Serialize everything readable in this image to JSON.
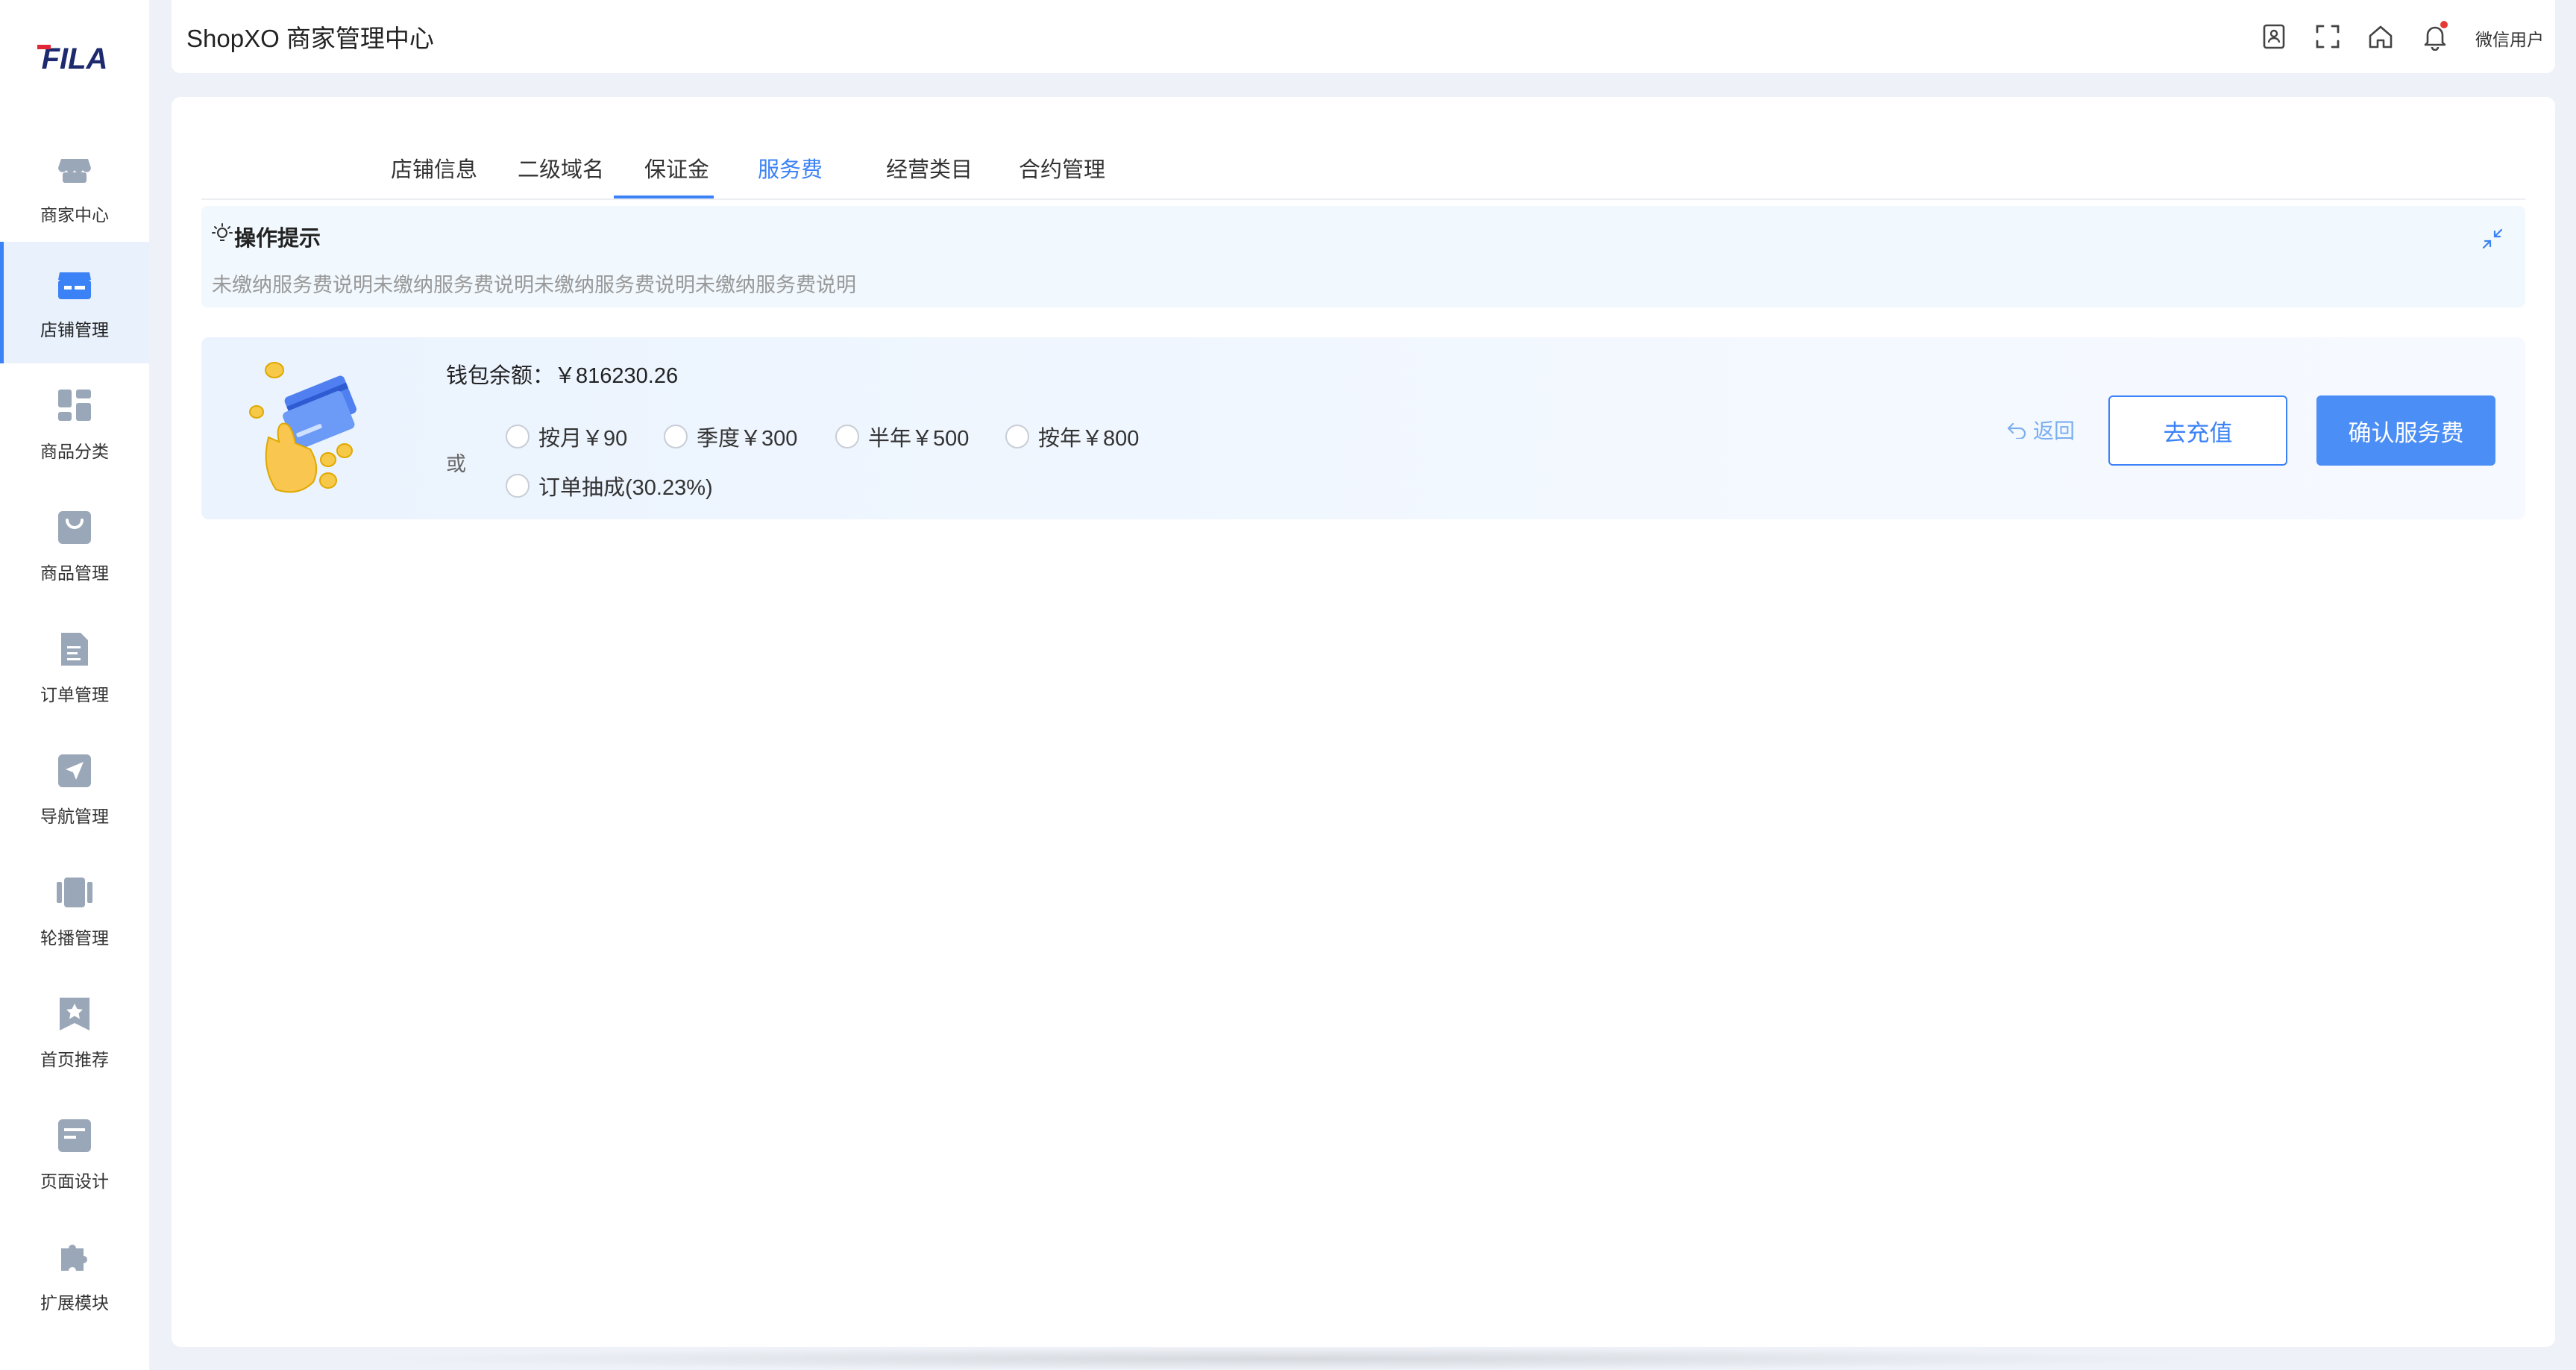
{
  "brand": {
    "logo_text": "FILA",
    "brand_color": "#1e2a6e",
    "accent_color": "#e32636"
  },
  "sidebar": {
    "items": [
      {
        "label": "商家中心",
        "icon": "store-awning-icon"
      },
      {
        "label": "店铺管理",
        "icon": "shop-icon",
        "active": true
      },
      {
        "label": "商品分类",
        "icon": "category-grid-icon"
      },
      {
        "label": "商品管理",
        "icon": "shopping-bag-icon"
      },
      {
        "label": "订单管理",
        "icon": "document-icon"
      },
      {
        "label": "导航管理",
        "icon": "navigation-arrow-icon"
      },
      {
        "label": "轮播管理",
        "icon": "carousel-icon"
      },
      {
        "label": "首页推荐",
        "icon": "star-bookmark-icon"
      },
      {
        "label": "页面设计",
        "icon": "page-layout-icon"
      },
      {
        "label": "扩展模块",
        "icon": "puzzle-icon"
      }
    ]
  },
  "header": {
    "title": "ShopXO 商家管理中心",
    "icons": [
      "contact-book-icon",
      "fullscreen-icon",
      "home-icon",
      "bell-icon"
    ],
    "user": "微信用户",
    "notification_dot_color": "#e53935"
  },
  "tabs": [
    {
      "label": "店铺信息"
    },
    {
      "label": "二级域名"
    },
    {
      "label": "保证金"
    },
    {
      "label": "服务费",
      "active": true
    },
    {
      "label": "经营类目"
    },
    {
      "label": "合约管理"
    }
  ],
  "tips": {
    "title": "操作提示",
    "text": "未缴纳服务费说明未缴纳服务费说明未缴纳服务费说明未缴纳服务费说明"
  },
  "fee": {
    "balance_label": "钱包余额：",
    "balance_value": "￥816230.26",
    "or_label": "或",
    "options": [
      {
        "label": "按月￥90"
      },
      {
        "label": "季度￥300"
      },
      {
        "label": "半年￥500"
      },
      {
        "label": "按年￥800"
      },
      {
        "label": "订单抽成(30.23%)"
      }
    ],
    "back_label": "返回",
    "recharge_label": "去充值",
    "confirm_label": "确认服务费"
  },
  "colors": {
    "primary": "#3b82f6",
    "sidebar_active_bg": "#e9f1fd",
    "icon_gray": "#9aa7b8"
  }
}
